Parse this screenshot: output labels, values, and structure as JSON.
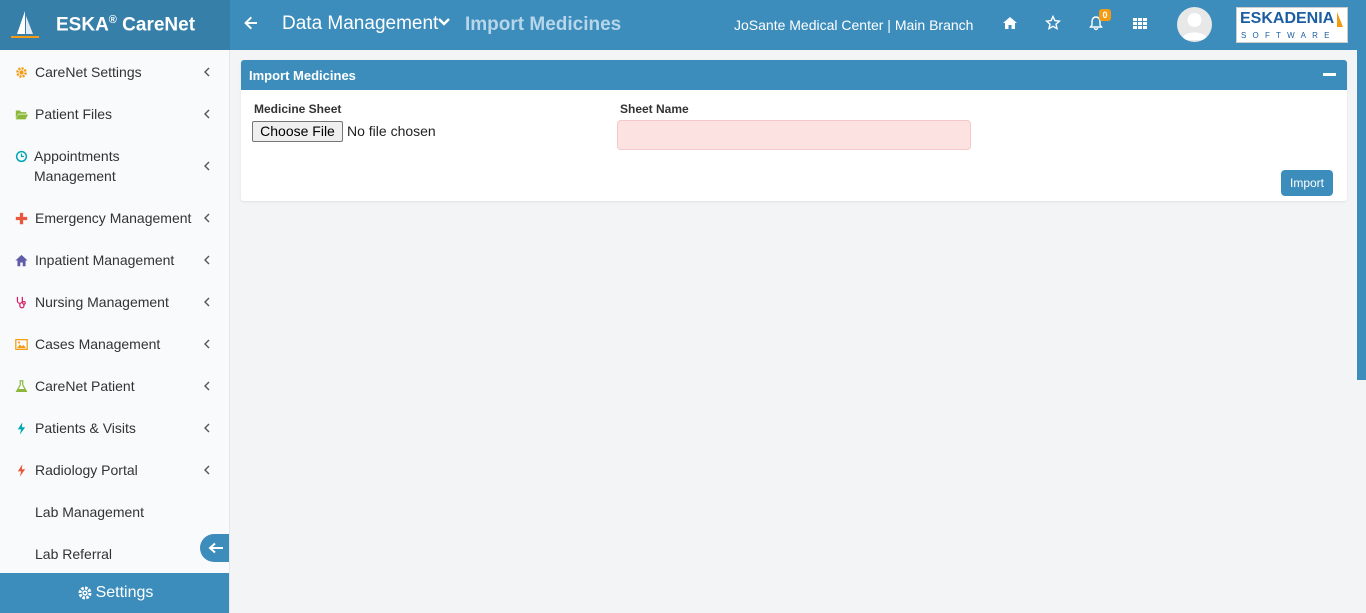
{
  "brand": {
    "name": "ESKA",
    "reg": "®",
    "suffix": " CareNet"
  },
  "header": {
    "section": "Data Management",
    "page": "Import Medicines",
    "branch": "JoSante Medical Center | Main Branch",
    "notifications_count": "0",
    "vendor_logo_main": "ESKADENIA",
    "vendor_logo_sub": "SOFTWARE"
  },
  "sidebar": {
    "items": [
      {
        "label": "CareNet Settings",
        "icon": "gear-icon",
        "color": "#f39c12"
      },
      {
        "label": "Patient Files",
        "icon": "folder-open-icon",
        "color": "#8bb83b"
      },
      {
        "label": "Appointments",
        "label2": "Management",
        "icon": "clock-icon",
        "color": "#00a7b3"
      },
      {
        "label": "Emergency Management",
        "icon": "plus-icon",
        "color": "#e9573f"
      },
      {
        "label": "Inpatient Management",
        "icon": "home-icon",
        "color": "#605ca8"
      },
      {
        "label": "Nursing Management",
        "icon": "stethoscope-icon",
        "color": "#d81b60"
      },
      {
        "label": "Cases Management",
        "icon": "image-icon",
        "color": "#f39c12"
      },
      {
        "label": "CareNet Patient",
        "icon": "flask-icon",
        "color": "#8bb83b"
      },
      {
        "label": "Patients & Visits",
        "icon": "bolt-icon",
        "color": "#00a7b3"
      },
      {
        "label": "Radiology Portal",
        "icon": "bolt-icon",
        "color": "#e9573f"
      },
      {
        "label": "Lab Management"
      },
      {
        "label": "Lab Referral"
      }
    ],
    "settings_label": "Settings"
  },
  "panel": {
    "title": "Import Medicines",
    "medicine_sheet_label": "Medicine Sheet",
    "choose_file_label": "Choose File",
    "file_status": "No file chosen",
    "sheet_name_label": "Sheet Name",
    "sheet_name_value": "",
    "import_label": "Import"
  }
}
